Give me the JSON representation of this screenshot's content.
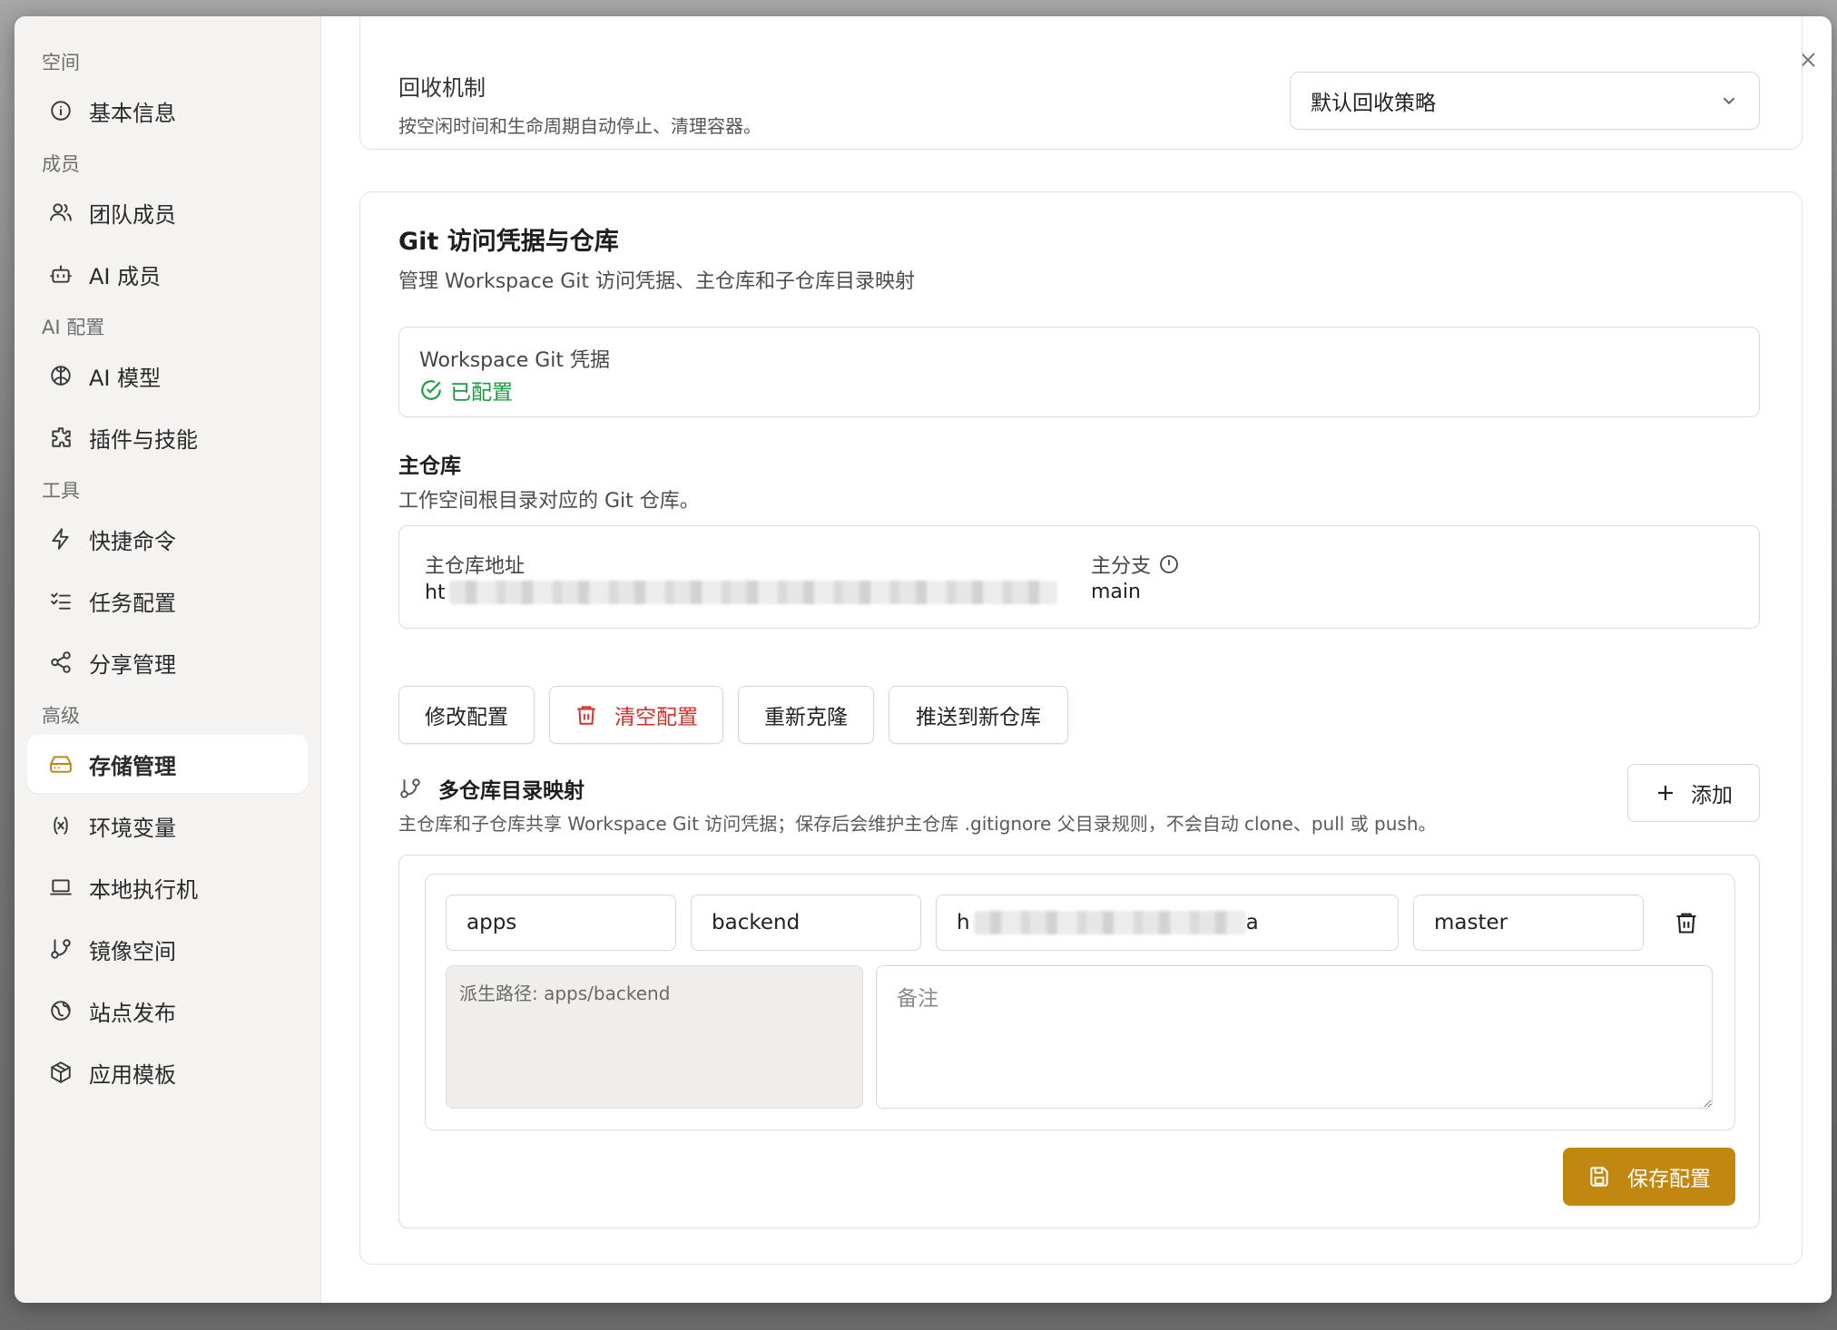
{
  "sidebar": {
    "groups": [
      {
        "label": "空间",
        "items": [
          {
            "label": "基本信息",
            "icon": "info-icon"
          }
        ]
      },
      {
        "label": "成员",
        "items": [
          {
            "label": "团队成员",
            "icon": "users-icon"
          },
          {
            "label": "AI 成员",
            "icon": "bot-icon"
          }
        ]
      },
      {
        "label": "AI 配置",
        "items": [
          {
            "label": "AI 模型",
            "icon": "brain-icon"
          },
          {
            "label": "插件与技能",
            "icon": "puzzle-icon"
          }
        ]
      },
      {
        "label": "工具",
        "items": [
          {
            "label": "快捷命令",
            "icon": "zap-icon"
          },
          {
            "label": "任务配置",
            "icon": "list-checks-icon"
          },
          {
            "label": "分享管理",
            "icon": "share-icon"
          }
        ]
      },
      {
        "label": "高级",
        "items": [
          {
            "label": "存储管理",
            "icon": "hard-drive-icon",
            "active": true
          },
          {
            "label": "环境变量",
            "icon": "variable-icon"
          },
          {
            "label": "本地执行机",
            "icon": "laptop-icon"
          },
          {
            "label": "镜像空间",
            "icon": "git-branch-icon"
          },
          {
            "label": "站点发布",
            "icon": "globe-icon"
          },
          {
            "label": "应用模板",
            "icon": "package-icon"
          }
        ]
      }
    ]
  },
  "recycle": {
    "title": "回收机制",
    "desc": "按空闲时间和生命周期自动停止、清理容器。",
    "select_value": "默认回收策略"
  },
  "git": {
    "title": "Git 访问凭据与仓库",
    "desc": "管理 Workspace Git 访问凭据、主仓库和子仓库目录映射",
    "credential_label": "Workspace Git 凭据",
    "credential_status": "已配置",
    "main_repo_title": "主仓库",
    "main_repo_desc": "工作空间根目录对应的 Git 仓库。",
    "repo_url_label": "主仓库地址",
    "repo_url_value": "ht",
    "branch_label": "主分支",
    "branch_value": "main",
    "buttons": {
      "edit": "修改配置",
      "clear": "清空配置",
      "reclone": "重新克隆",
      "push_new": "推送到新仓库"
    },
    "mapping_title": "多仓库目录映射",
    "mapping_desc": "主仓库和子仓库共享 Workspace Git 访问凭据；保存后会维护主仓库 .gitignore 父目录规则，不会自动 clone、pull 或 push。",
    "add_label": "添加",
    "mapping": {
      "dir": "apps",
      "name": "backend",
      "url": "h",
      "url_tail": "a",
      "branch": "master",
      "derived_path": "派生路径: apps/backend",
      "note_placeholder": "备注"
    },
    "save_label": "保存配置"
  },
  "colors": {
    "accent": "#c28710",
    "success": "#1e9a44",
    "danger": "#d0302a"
  }
}
